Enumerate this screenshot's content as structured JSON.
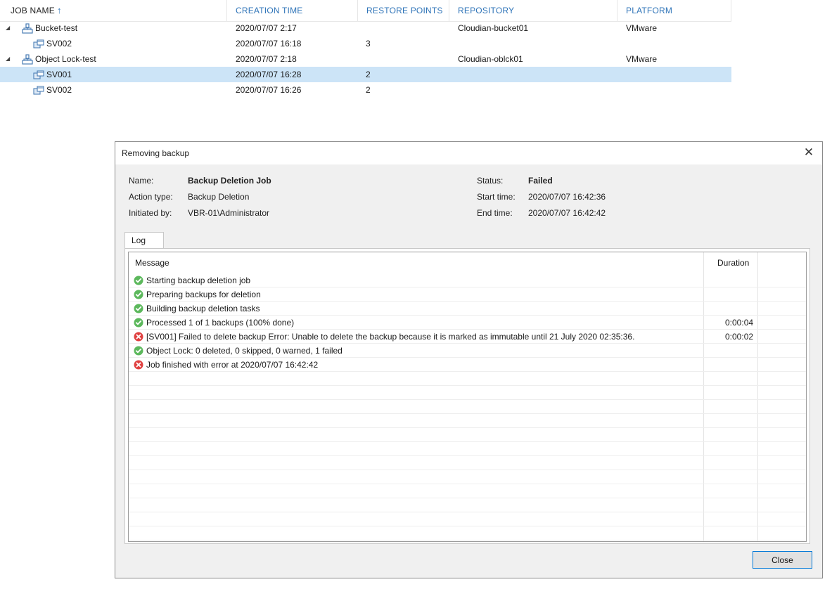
{
  "grid": {
    "columns": {
      "job_name": "JOB NAME",
      "creation_time": "CREATION TIME",
      "restore_points": "RESTORE POINTS",
      "repository": "REPOSITORY",
      "platform": "PLATFORM"
    },
    "sort_indicator": "↑",
    "rows": [
      {
        "name": "Bucket-test",
        "created": "2020/07/07 2:17",
        "points": "",
        "repo": "Cloudian-bucket01",
        "platform": "VMware"
      },
      {
        "name": "SV002",
        "created": "2020/07/07 16:18",
        "points": "3",
        "repo": "",
        "platform": ""
      },
      {
        "name": "Object Lock-test",
        "created": "2020/07/07 2:18",
        "points": "",
        "repo": "Cloudian-oblck01",
        "platform": "VMware"
      },
      {
        "name": "SV001",
        "created": "2020/07/07 16:28",
        "points": "2",
        "repo": "",
        "platform": ""
      },
      {
        "name": "SV002",
        "created": "2020/07/07 16:26",
        "points": "2",
        "repo": "",
        "platform": ""
      }
    ]
  },
  "dialog": {
    "title": "Removing backup",
    "close_glyph": "✕",
    "name_label": "Name:",
    "name_value": "Backup Deletion Job",
    "action_label": "Action type:",
    "action_value": "Backup Deletion",
    "initiated_label": "Initiated by:",
    "initiated_value": "VBR-01\\Administrator",
    "status_label": "Status:",
    "status_value": "Failed",
    "start_label": "Start time:",
    "start_value": "2020/07/07 16:42:36",
    "end_label": "End time:",
    "end_value": "2020/07/07 16:42:42",
    "tab_label": "Log",
    "log_headers": {
      "message": "Message",
      "duration": "Duration"
    },
    "log": [
      {
        "status": "success",
        "message": "Starting backup deletion job",
        "duration": ""
      },
      {
        "status": "success",
        "message": "Preparing backups for deletion",
        "duration": ""
      },
      {
        "status": "success",
        "message": "Building backup deletion tasks",
        "duration": ""
      },
      {
        "status": "success",
        "message": "Processed 1 of 1 backups (100% done)",
        "duration": "0:00:04"
      },
      {
        "status": "error",
        "message": "[SV001] Failed to delete backup Error: Unable to delete the backup because it is marked as immutable until 21 July 2020 02:35:36.",
        "duration": "0:00:02"
      },
      {
        "status": "success",
        "message": "Object Lock: 0 deleted, 0 skipped, 0 warned, 1 failed",
        "duration": ""
      },
      {
        "status": "error",
        "message": "Job finished with error at 2020/07/07 16:42:42",
        "duration": ""
      }
    ],
    "close_button": "Close"
  },
  "colors": {
    "header_link": "#2f74b8",
    "selected_row": "#cce4f7",
    "success": "#5cb85c",
    "error": "#e04040",
    "button_border": "#0078d7"
  }
}
